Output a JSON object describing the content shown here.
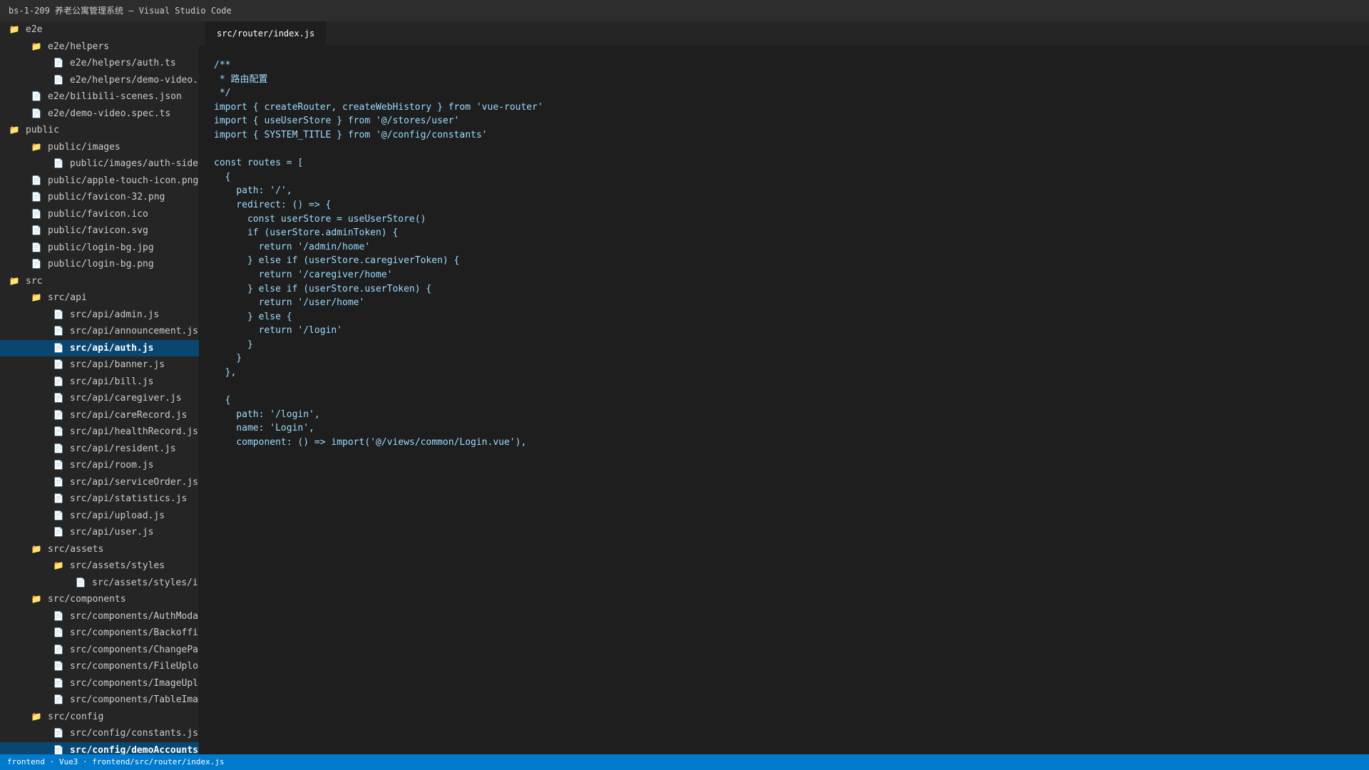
{
  "window": {
    "title": "bs-1-209 养老公寓管理系统 — Visual Studio Code"
  },
  "colors": {
    "accent": "#007acc",
    "selection": "#094771",
    "code_text": "#9cdcfe",
    "folder_icon": "#dcb67a"
  },
  "explorer": {
    "items": [
      {
        "label": "e2e",
        "kind": "folder",
        "depth": 0
      },
      {
        "label": "e2e/helpers",
        "kind": "folder",
        "depth": 1
      },
      {
        "label": "e2e/helpers/auth.ts",
        "kind": "file",
        "depth": 2
      },
      {
        "label": "e2e/helpers/demo-video.",
        "kind": "file",
        "depth": 2
      },
      {
        "label": "e2e/bilibili-scenes.json",
        "kind": "file",
        "depth": 1
      },
      {
        "label": "e2e/demo-video.spec.ts",
        "kind": "file",
        "depth": 1
      },
      {
        "label": "public",
        "kind": "folder",
        "depth": 0
      },
      {
        "label": "public/images",
        "kind": "folder",
        "depth": 1
      },
      {
        "label": "public/images/auth-side",
        "kind": "file",
        "depth": 2
      },
      {
        "label": "public/apple-touch-icon.png",
        "kind": "file",
        "depth": 1
      },
      {
        "label": "public/favicon-32.png",
        "kind": "file",
        "depth": 1
      },
      {
        "label": "public/favicon.ico",
        "kind": "file",
        "depth": 1
      },
      {
        "label": "public/favicon.svg",
        "kind": "file",
        "depth": 1
      },
      {
        "label": "public/login-bg.jpg",
        "kind": "file",
        "depth": 1
      },
      {
        "label": "public/login-bg.png",
        "kind": "file",
        "depth": 1
      },
      {
        "label": "src",
        "kind": "folder",
        "depth": 0
      },
      {
        "label": "src/api",
        "kind": "folder",
        "depth": 1
      },
      {
        "label": "src/api/admin.js",
        "kind": "file",
        "depth": 2
      },
      {
        "label": "src/api/announcement.js",
        "kind": "file",
        "depth": 2
      },
      {
        "label": "src/api/auth.js",
        "kind": "file",
        "depth": 2,
        "selected": true
      },
      {
        "label": "src/api/banner.js",
        "kind": "file",
        "depth": 2
      },
      {
        "label": "src/api/bill.js",
        "kind": "file",
        "depth": 2
      },
      {
        "label": "src/api/caregiver.js",
        "kind": "file",
        "depth": 2
      },
      {
        "label": "src/api/careRecord.js",
        "kind": "file",
        "depth": 2
      },
      {
        "label": "src/api/healthRecord.js",
        "kind": "file",
        "depth": 2
      },
      {
        "label": "src/api/resident.js",
        "kind": "file",
        "depth": 2
      },
      {
        "label": "src/api/room.js",
        "kind": "file",
        "depth": 2
      },
      {
        "label": "src/api/serviceOrder.js",
        "kind": "file",
        "depth": 2
      },
      {
        "label": "src/api/statistics.js",
        "kind": "file",
        "depth": 2
      },
      {
        "label": "src/api/upload.js",
        "kind": "file",
        "depth": 2
      },
      {
        "label": "src/api/user.js",
        "kind": "file",
        "depth": 2
      },
      {
        "label": "src/assets",
        "kind": "folder",
        "depth": 1
      },
      {
        "label": "src/assets/styles",
        "kind": "folder",
        "depth": 2
      },
      {
        "label": "src/assets/styles/i",
        "kind": "file",
        "depth": 3
      },
      {
        "label": "src/components",
        "kind": "folder",
        "depth": 1
      },
      {
        "label": "src/components/AuthModa",
        "kind": "file",
        "depth": 2
      },
      {
        "label": "src/components/Backoffic",
        "kind": "file",
        "depth": 2
      },
      {
        "label": "src/components/ChangePa",
        "kind": "file",
        "depth": 2
      },
      {
        "label": "src/components/FileUploa",
        "kind": "file",
        "depth": 2
      },
      {
        "label": "src/components/ImageUplo",
        "kind": "file",
        "depth": 2
      },
      {
        "label": "src/components/TableImag",
        "kind": "file",
        "depth": 2
      },
      {
        "label": "src/config",
        "kind": "folder",
        "depth": 1
      },
      {
        "label": "src/config/constants.js",
        "kind": "file",
        "depth": 2
      },
      {
        "label": "src/config/demoAccounts",
        "kind": "file",
        "depth": 2,
        "selected": true
      }
    ]
  },
  "editor": {
    "tabs": [
      {
        "label": "src/router/index.js",
        "active": true
      }
    ],
    "lines": [
      "/**",
      " * 路由配置",
      " */",
      "import { createRouter, createWebHistory } from 'vue-router'",
      "import { useUserStore } from '@/stores/user'",
      "import { SYSTEM_TITLE } from '@/config/constants'",
      "",
      "const routes = [",
      "  {",
      "    path: '/',",
      "    redirect: () => {",
      "      const userStore = useUserStore()",
      "      if (userStore.adminToken) {",
      "        return '/admin/home'",
      "      } else if (userStore.caregiverToken) {",
      "        return '/caregiver/home'",
      "      } else if (userStore.userToken) {",
      "        return '/user/home'",
      "      } else {",
      "        return '/login'",
      "      }",
      "    }",
      "  },",
      "",
      "  {",
      "    path: '/login',",
      "    name: 'Login',",
      "    component: () => import('@/views/common/Login.vue'),"
    ]
  },
  "statusbar": {
    "text": "frontend · Vue3 · frontend/src/router/index.js"
  }
}
